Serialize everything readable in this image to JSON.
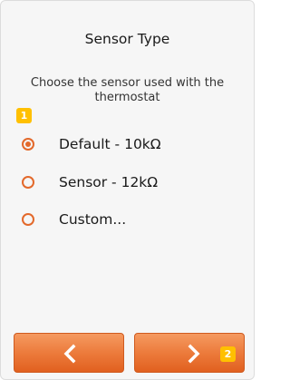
{
  "screen": {
    "title": "Sensor Type",
    "description": "Choose the sensor used with the thermostat"
  },
  "step_badges": {
    "first": "1",
    "second": "2"
  },
  "options": [
    {
      "label": "Default - 10kΩ",
      "selected": true
    },
    {
      "label": "Sensor - 12kΩ",
      "selected": false
    },
    {
      "label": "Custom...",
      "selected": false
    }
  ],
  "navigation": {
    "back_icon": "chevron-left-icon",
    "next_icon": "chevron-right-icon"
  },
  "colors": {
    "accent": "#e3692b",
    "button_top": "#f59a60",
    "button_bottom": "#e1601f",
    "badge": "#ffc000",
    "background": "#f6f6f6"
  }
}
